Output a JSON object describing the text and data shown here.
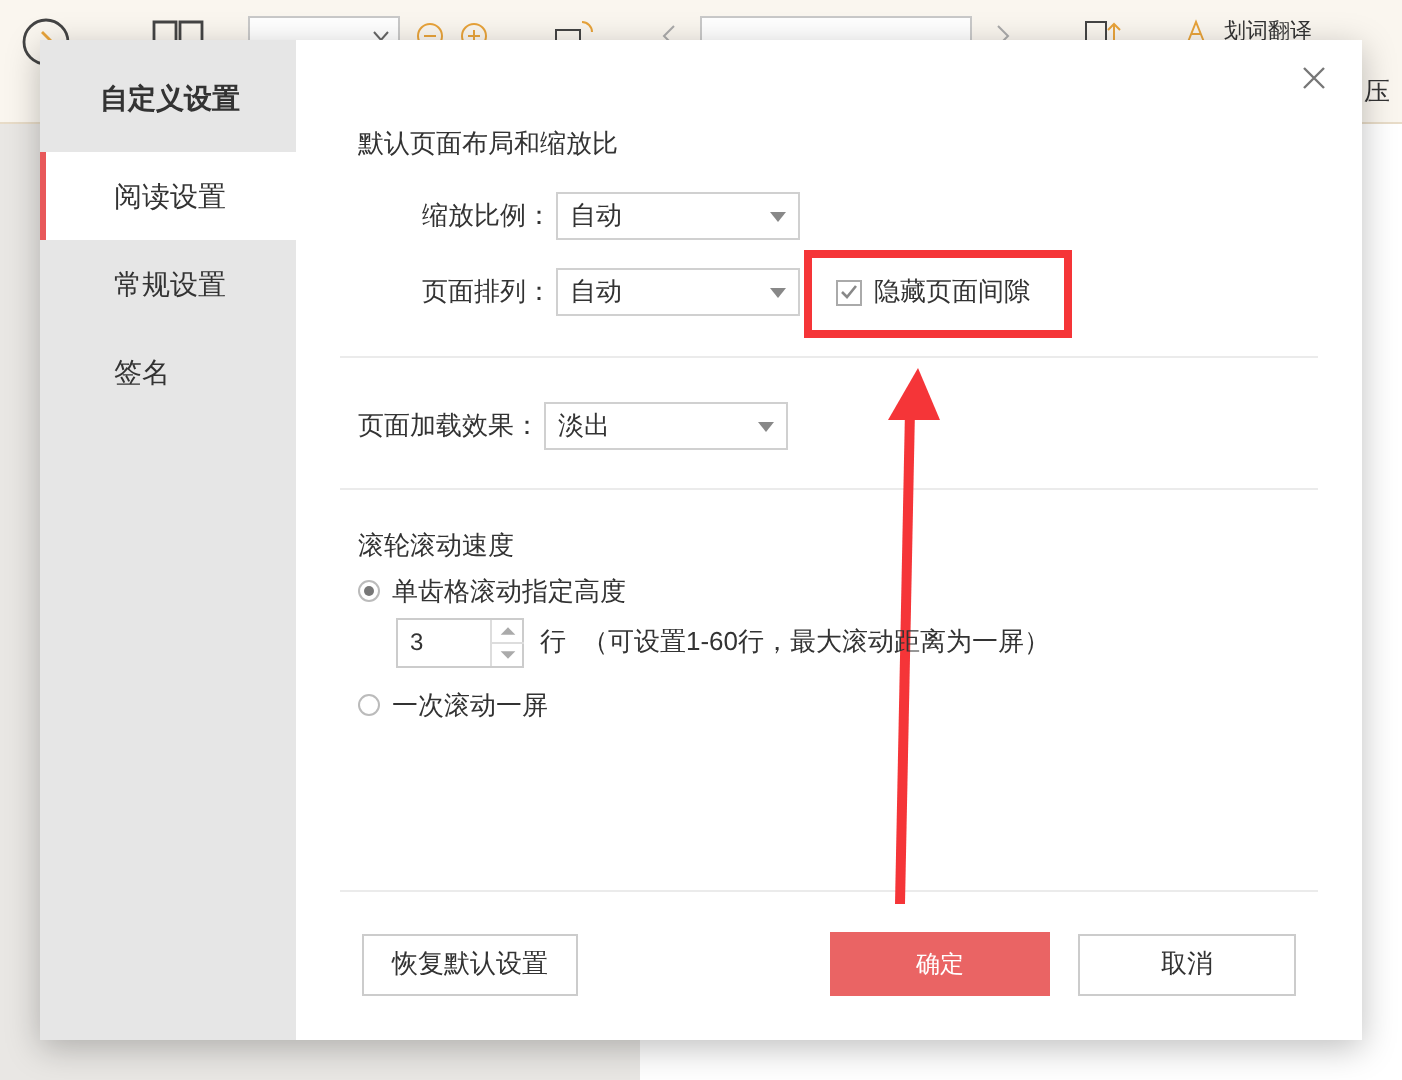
{
  "toolbar": {
    "translate_label": "划词翻译",
    "edge_label": "压"
  },
  "dialog": {
    "title": "自定义设置",
    "sidebar": {
      "items": [
        {
          "label": "阅读设置",
          "selected": true
        },
        {
          "label": "常规设置",
          "selected": false
        },
        {
          "label": "签名",
          "selected": false
        }
      ]
    },
    "layout_section": {
      "heading": "默认页面布局和缩放比",
      "zoom_label": "缩放比例：",
      "zoom_value": "自动",
      "arrange_label": "页面排列：",
      "arrange_value": "自动",
      "hide_gap": {
        "label": "隐藏页面间隙",
        "checked": true
      }
    },
    "load_effect": {
      "label": "页面加载效果：",
      "value": "淡出"
    },
    "scroll_section": {
      "heading": "滚轮滚动速度",
      "options": [
        {
          "label": "单齿格滚动指定高度",
          "selected": true
        },
        {
          "label": "一次滚动一屏",
          "selected": false
        }
      ],
      "lines_value": "3",
      "lines_unit": "行",
      "hint": "（可设置1-60行，最大滚动距离为一屏）"
    },
    "buttons": {
      "reset": "恢复默认设置",
      "confirm": "确定",
      "cancel": "取消"
    }
  }
}
